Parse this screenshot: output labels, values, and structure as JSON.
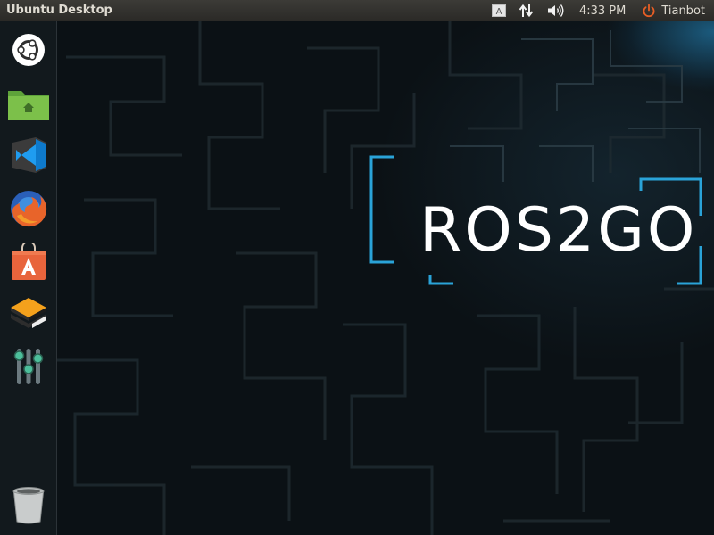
{
  "panel": {
    "title": "Ubuntu Desktop",
    "keyboard_indicator": "A",
    "clock": "4:33 PM",
    "user": "Tianbot"
  },
  "launcher": {
    "items": [
      {
        "name": "Ubuntu Dash",
        "icon": "ubuntu-logo-icon"
      },
      {
        "name": "Home Folder",
        "icon": "home-folder-icon"
      },
      {
        "name": "Visual Studio Code",
        "icon": "vscode-icon"
      },
      {
        "name": "Firefox",
        "icon": "firefox-icon"
      },
      {
        "name": "Ubuntu Software",
        "icon": "software-center-icon"
      },
      {
        "name": "Application",
        "icon": "layered-box-icon"
      },
      {
        "name": "Settings",
        "icon": "sliders-icon"
      },
      {
        "name": "Trash",
        "icon": "trash-icon"
      }
    ]
  },
  "desktop": {
    "logo_text": "ROS2GO"
  },
  "colors": {
    "accent_blue": "#2aa3d8",
    "folder_green": "#7cc04a",
    "software_orange": "#e8643c",
    "firefox_orange": "#e8642a",
    "panel_bg": "#3c3b37",
    "power_icon": "#e85e25"
  }
}
